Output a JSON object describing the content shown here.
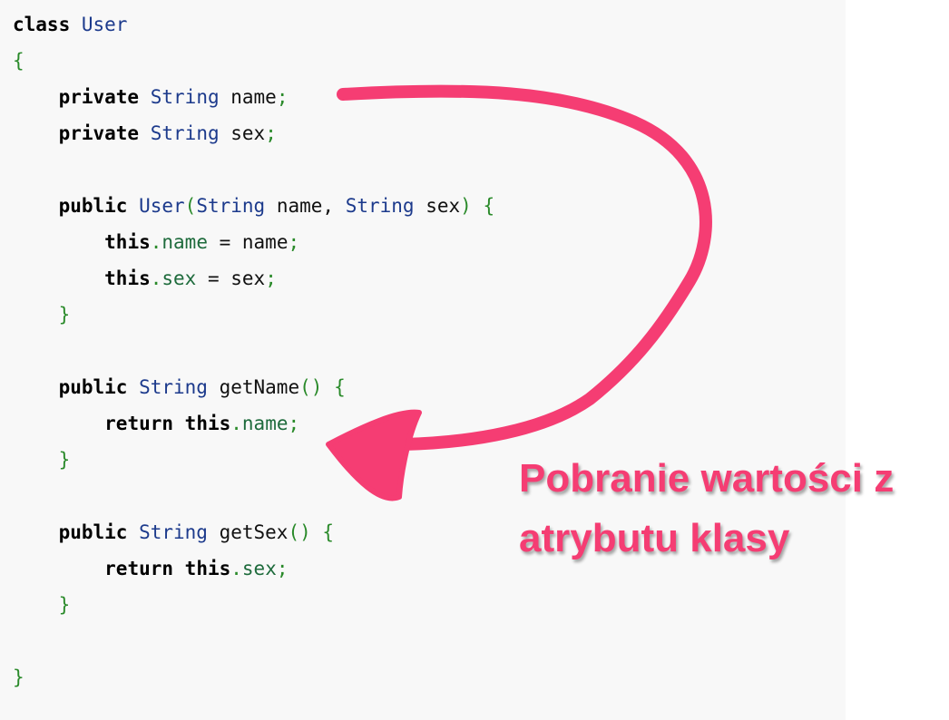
{
  "code": {
    "lines": [
      [
        {
          "t": "class",
          "c": "kw"
        },
        {
          "t": " ",
          "c": "id"
        },
        {
          "t": "User",
          "c": "ty"
        }
      ],
      [
        {
          "t": "{",
          "c": "pu"
        }
      ],
      [
        {
          "t": "    ",
          "c": "id"
        },
        {
          "t": "private",
          "c": "kw"
        },
        {
          "t": " ",
          "c": "id"
        },
        {
          "t": "String",
          "c": "ty"
        },
        {
          "t": " name",
          "c": "id"
        },
        {
          "t": ";",
          "c": "pu"
        }
      ],
      [
        {
          "t": "    ",
          "c": "id"
        },
        {
          "t": "private",
          "c": "kw"
        },
        {
          "t": " ",
          "c": "id"
        },
        {
          "t": "String",
          "c": "ty"
        },
        {
          "t": " sex",
          "c": "id"
        },
        {
          "t": ";",
          "c": "pu"
        }
      ],
      [],
      [
        {
          "t": "    ",
          "c": "id"
        },
        {
          "t": "public",
          "c": "kw"
        },
        {
          "t": " ",
          "c": "id"
        },
        {
          "t": "User",
          "c": "ty"
        },
        {
          "t": "(",
          "c": "pu"
        },
        {
          "t": "String",
          "c": "ty"
        },
        {
          "t": " name, ",
          "c": "id"
        },
        {
          "t": "String",
          "c": "ty"
        },
        {
          "t": " sex",
          "c": "id"
        },
        {
          "t": ")",
          "c": "pu"
        },
        {
          "t": " ",
          "c": "id"
        },
        {
          "t": "{",
          "c": "pu"
        }
      ],
      [
        {
          "t": "        ",
          "c": "id"
        },
        {
          "t": "this",
          "c": "kw"
        },
        {
          "t": ".",
          "c": "pu"
        },
        {
          "t": "name",
          "c": "fld"
        },
        {
          "t": " = name",
          "c": "id"
        },
        {
          "t": ";",
          "c": "pu"
        }
      ],
      [
        {
          "t": "        ",
          "c": "id"
        },
        {
          "t": "this",
          "c": "kw"
        },
        {
          "t": ".",
          "c": "pu"
        },
        {
          "t": "sex",
          "c": "fld"
        },
        {
          "t": " = sex",
          "c": "id"
        },
        {
          "t": ";",
          "c": "pu"
        }
      ],
      [
        {
          "t": "    ",
          "c": "id"
        },
        {
          "t": "}",
          "c": "pu"
        }
      ],
      [],
      [
        {
          "t": "    ",
          "c": "id"
        },
        {
          "t": "public",
          "c": "kw"
        },
        {
          "t": " ",
          "c": "id"
        },
        {
          "t": "String",
          "c": "ty"
        },
        {
          "t": " getName",
          "c": "id"
        },
        {
          "t": "()",
          "c": "pu"
        },
        {
          "t": " ",
          "c": "id"
        },
        {
          "t": "{",
          "c": "pu"
        }
      ],
      [
        {
          "t": "        ",
          "c": "id"
        },
        {
          "t": "return",
          "c": "kw"
        },
        {
          "t": " ",
          "c": "id"
        },
        {
          "t": "this",
          "c": "kw"
        },
        {
          "t": ".",
          "c": "pu"
        },
        {
          "t": "name",
          "c": "fld"
        },
        {
          "t": ";",
          "c": "pu"
        }
      ],
      [
        {
          "t": "    ",
          "c": "id"
        },
        {
          "t": "}",
          "c": "pu"
        }
      ],
      [],
      [
        {
          "t": "    ",
          "c": "id"
        },
        {
          "t": "public",
          "c": "kw"
        },
        {
          "t": " ",
          "c": "id"
        },
        {
          "t": "String",
          "c": "ty"
        },
        {
          "t": " getSex",
          "c": "id"
        },
        {
          "t": "()",
          "c": "pu"
        },
        {
          "t": " ",
          "c": "id"
        },
        {
          "t": "{",
          "c": "pu"
        }
      ],
      [
        {
          "t": "        ",
          "c": "id"
        },
        {
          "t": "return",
          "c": "kw"
        },
        {
          "t": " ",
          "c": "id"
        },
        {
          "t": "this",
          "c": "kw"
        },
        {
          "t": ".",
          "c": "pu"
        },
        {
          "t": "sex",
          "c": "fld"
        },
        {
          "t": ";",
          "c": "pu"
        }
      ],
      [
        {
          "t": "    ",
          "c": "id"
        },
        {
          "t": "}",
          "c": "pu"
        }
      ],
      [],
      [
        {
          "t": "}",
          "c": "pu"
        }
      ]
    ]
  },
  "annotation": {
    "line1": "Pobranie wartości z",
    "line2": "atrybutu klasy",
    "color": "#f53d73"
  },
  "colors": {
    "keyword": "#000000",
    "type": "#1c3a8c",
    "punctuation": "#2a8a2a",
    "field": "#1e6b3c",
    "background": "#f8f8f8"
  }
}
